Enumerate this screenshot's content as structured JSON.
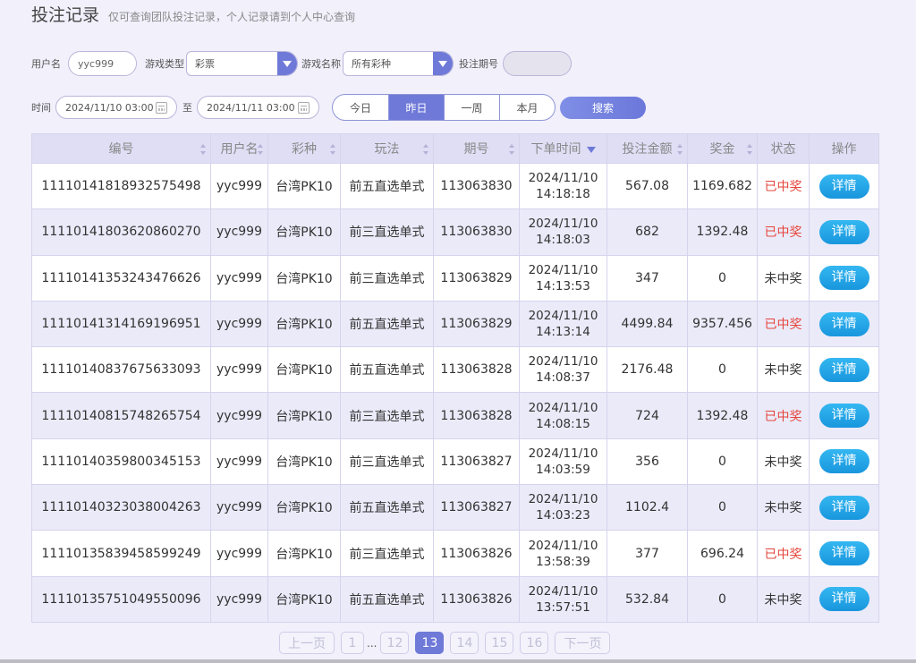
{
  "header": {
    "title": "投注记录",
    "subtitle": "仅可查询团队投注记录，个人记录请到个人中心查询"
  },
  "filters": {
    "username_label": "用户名",
    "username_value": "yyc999",
    "game_type_label": "游戏类型",
    "game_type_value": "彩票",
    "game_name_label": "游戏名称",
    "game_name_value": "所有彩种",
    "period_label": "投注期号",
    "period_value": "",
    "time_label": "时间",
    "time_from": "2024/11/10 03:00",
    "to_label": "至",
    "time_to": "2024/11/11 03:00",
    "quick_ranges": [
      "今日",
      "昨日",
      "一周",
      "本月"
    ],
    "active_range": "昨日",
    "search_label": "搜索"
  },
  "table": {
    "columns": [
      "编号",
      "用户名",
      "彩种",
      "玩法",
      "期号",
      "下单时间",
      "投注金额",
      "奖金",
      "状态",
      "操作"
    ],
    "rows": [
      {
        "id": "11110141818932575498",
        "user": "yyc999",
        "lottery": "台湾PK10",
        "play": "前五直选单式",
        "period": "113063830",
        "date": "2024/11/10",
        "time": "14:18:18",
        "amount": "567.08",
        "prize": "1169.682",
        "status": "已中奖",
        "won": true,
        "action": "详情"
      },
      {
        "id": "11110141803620860270",
        "user": "yyc999",
        "lottery": "台湾PK10",
        "play": "前三直选单式",
        "period": "113063830",
        "date": "2024/11/10",
        "time": "14:18:03",
        "amount": "682",
        "prize": "1392.48",
        "status": "已中奖",
        "won": true,
        "action": "详情"
      },
      {
        "id": "11110141353243476626",
        "user": "yyc999",
        "lottery": "台湾PK10",
        "play": "前三直选单式",
        "period": "113063829",
        "date": "2024/11/10",
        "time": "14:13:53",
        "amount": "347",
        "prize": "0",
        "status": "未中奖",
        "won": false,
        "action": "详情"
      },
      {
        "id": "11110141314169196951",
        "user": "yyc999",
        "lottery": "台湾PK10",
        "play": "前五直选单式",
        "period": "113063829",
        "date": "2024/11/10",
        "time": "14:13:14",
        "amount": "4499.84",
        "prize": "9357.456",
        "status": "已中奖",
        "won": true,
        "action": "详情"
      },
      {
        "id": "11110140837675633093",
        "user": "yyc999",
        "lottery": "台湾PK10",
        "play": "前五直选单式",
        "period": "113063828",
        "date": "2024/11/10",
        "time": "14:08:37",
        "amount": "2176.48",
        "prize": "0",
        "status": "未中奖",
        "won": false,
        "action": "详情"
      },
      {
        "id": "11110140815748265754",
        "user": "yyc999",
        "lottery": "台湾PK10",
        "play": "前三直选单式",
        "period": "113063828",
        "date": "2024/11/10",
        "time": "14:08:15",
        "amount": "724",
        "prize": "1392.48",
        "status": "已中奖",
        "won": true,
        "action": "详情"
      },
      {
        "id": "11110140359800345153",
        "user": "yyc999",
        "lottery": "台湾PK10",
        "play": "前三直选单式",
        "period": "113063827",
        "date": "2024/11/10",
        "time": "14:03:59",
        "amount": "356",
        "prize": "0",
        "status": "未中奖",
        "won": false,
        "action": "详情"
      },
      {
        "id": "11110140323038004263",
        "user": "yyc999",
        "lottery": "台湾PK10",
        "play": "前五直选单式",
        "period": "113063827",
        "date": "2024/11/10",
        "time": "14:03:23",
        "amount": "1102.4",
        "prize": "0",
        "status": "未中奖",
        "won": false,
        "action": "详情"
      },
      {
        "id": "11110135839458599249",
        "user": "yyc999",
        "lottery": "台湾PK10",
        "play": "前三直选单式",
        "period": "113063826",
        "date": "2024/11/10",
        "time": "13:58:39",
        "amount": "377",
        "prize": "696.24",
        "status": "已中奖",
        "won": true,
        "action": "详情"
      },
      {
        "id": "11110135751049550096",
        "user": "yyc999",
        "lottery": "台湾PK10",
        "play": "前五直选单式",
        "period": "113063826",
        "date": "2024/11/10",
        "time": "13:57:51",
        "amount": "532.84",
        "prize": "0",
        "status": "未中奖",
        "won": false,
        "action": "详情"
      }
    ]
  },
  "pager": {
    "prev": "上一页",
    "next": "下一页",
    "pages": [
      "1",
      "12",
      "13",
      "14",
      "15",
      "16"
    ],
    "ellipsis": "...",
    "current": "13"
  },
  "colors": {
    "accent": "#6f79d8",
    "won": "#e5453b",
    "detail_button": "#1996dd"
  }
}
